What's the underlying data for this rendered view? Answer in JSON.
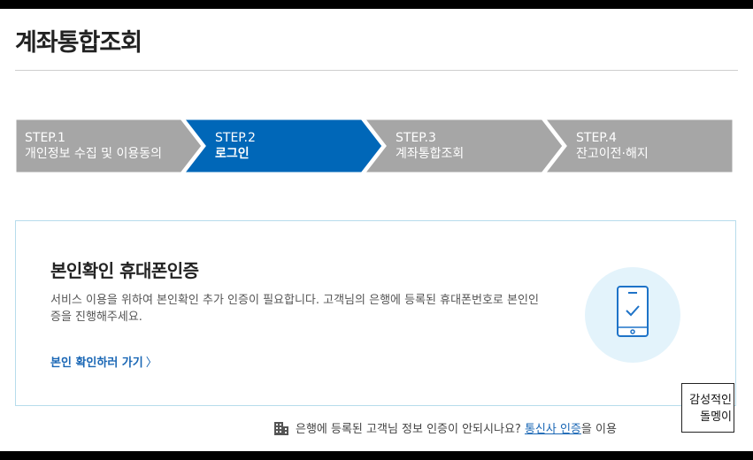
{
  "page": {
    "title": "계좌통합조회"
  },
  "steps": [
    {
      "num": "STEP.1",
      "label": "개인정보 수집 및 이용동의",
      "active": false
    },
    {
      "num": "STEP.2",
      "label": "로그인",
      "active": true
    },
    {
      "num": "STEP.3",
      "label": "계좌통합조회",
      "active": false
    },
    {
      "num": "STEP.4",
      "label": "잔고이전·해지",
      "active": false
    }
  ],
  "colors": {
    "step_active": "#0067b8",
    "step_inactive": "#a6a6a6",
    "link": "#1a67b5",
    "card_border": "#b7dcec"
  },
  "auth_card": {
    "heading": "본인확인 휴대폰인증",
    "description": "서비스 이용을 위하여 본인확인 추가 인증이 필요합니다. 고객님의 은행에 등록된 휴대폰번호로 본인인증을 진행해주세요.",
    "link_label": "본인 확인하러 가기",
    "link_chevron": "〉",
    "illustration": "phone-check-icon"
  },
  "footer": {
    "icon": "building-icon",
    "text_before": "은행에 등록된 고객님 정보 인증이 안되시나요?",
    "link": "통신사 인증",
    "text_after": "을 이용"
  },
  "overlay": {
    "line1": "감성적인",
    "line2": "돌멩이"
  }
}
